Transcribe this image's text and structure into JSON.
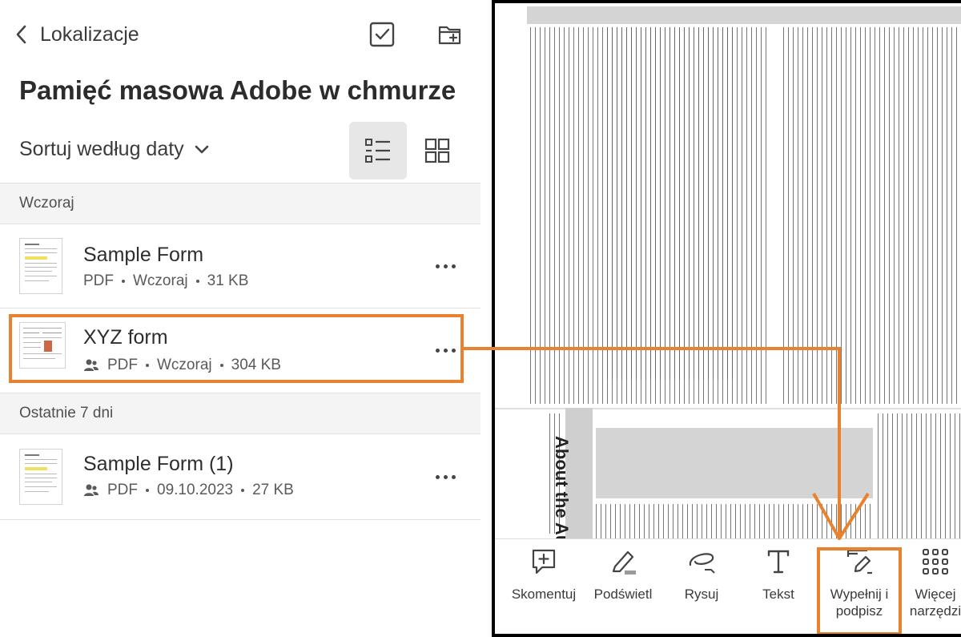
{
  "header": {
    "back_label": "Lokalizacje",
    "title": "Pamięć masowa Adobe w chmurze",
    "sort_label": "Sortuj według daty"
  },
  "sections": [
    {
      "label": "Wczoraj"
    },
    {
      "label": "Ostatnie 7 dni"
    }
  ],
  "files": [
    {
      "name": "Sample Form",
      "type": "PDF",
      "date": "Wczoraj",
      "size": "31 KB",
      "shared": false
    },
    {
      "name": "XYZ form",
      "type": "PDF",
      "date": "Wczoraj",
      "size": "304 KB",
      "shared": true
    },
    {
      "name": "Sample Form (1)",
      "type": "PDF",
      "date": "09.10.2023",
      "size": "27 KB",
      "shared": false
    }
  ],
  "viewer": {
    "vertical_heading": "About the Autho",
    "tools": [
      {
        "label": "Skomentuj",
        "icon": "comment-icon"
      },
      {
        "label": "Podświetl",
        "icon": "highlight-icon"
      },
      {
        "label": "Rysuj",
        "icon": "draw-icon"
      },
      {
        "label": "Tekst",
        "icon": "text-icon"
      },
      {
        "label": "Wypełnij i podpisz",
        "icon": "fill-sign-icon"
      },
      {
        "label": "Więcej narzędzi",
        "icon": "more-tools-icon"
      }
    ]
  },
  "colors": {
    "annotation": "#e8822e",
    "selected_view_bg": "#e7e7e7"
  }
}
